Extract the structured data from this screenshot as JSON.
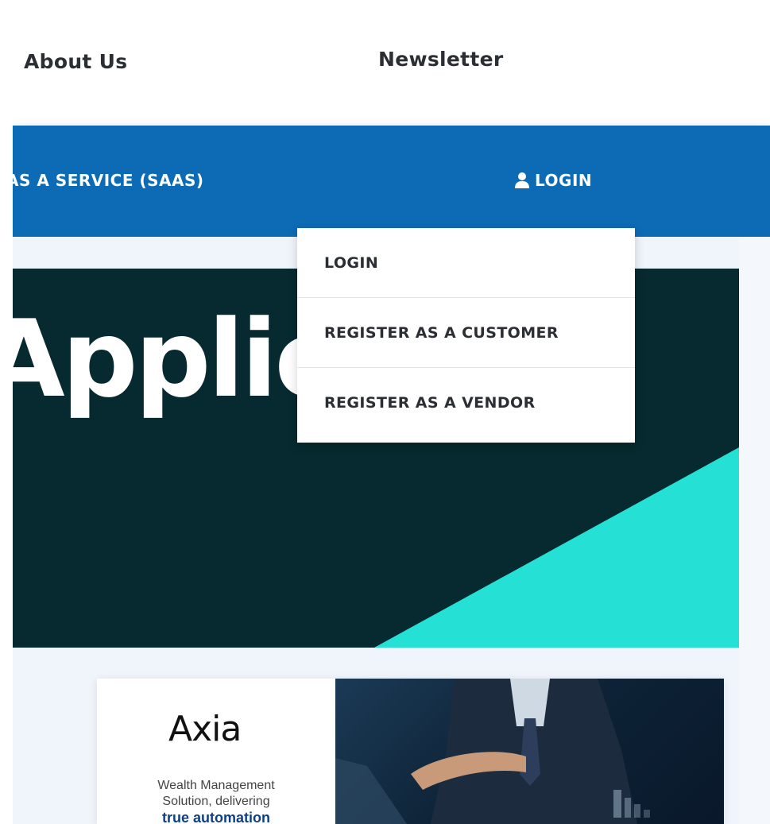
{
  "nav": {
    "about": "About Us",
    "newsletter": "Newsletter"
  },
  "bar": {
    "saas": "AS A SERVICE (SAAS)",
    "login": "LOGIN"
  },
  "hero": {
    "text": "Applic"
  },
  "dropdown": {
    "items": [
      {
        "label": "LOGIN"
      },
      {
        "label": "REGISTER AS A CUSTOMER"
      },
      {
        "label": "REGISTER AS A VENDOR"
      }
    ]
  },
  "card": {
    "logo": "Axia",
    "desc_line1": "Wealth Management",
    "desc_line2": "Solution, delivering",
    "desc_highlight": "true automation"
  },
  "colors": {
    "bar_blue": "#0d6ab5",
    "hero_dark": "#062a2f",
    "hero_accent": "#25e0d4"
  },
  "icons": {
    "login": "user-icon"
  }
}
